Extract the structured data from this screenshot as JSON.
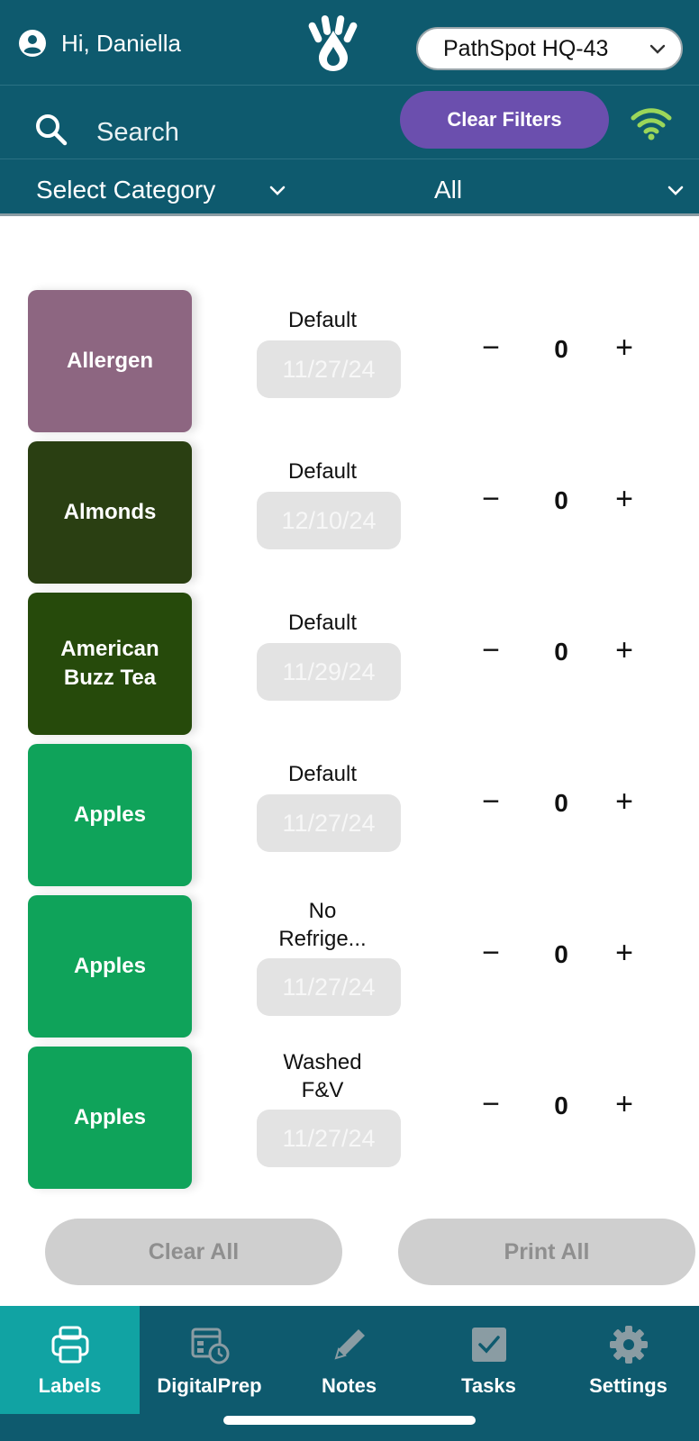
{
  "header": {
    "greeting": "Hi, Daniella",
    "location": "PathSpot HQ-43"
  },
  "search": {
    "placeholder": "Search",
    "clear_filters_label": "Clear Filters"
  },
  "category": {
    "label": "Select Category",
    "value": "All"
  },
  "items": [
    {
      "name": "Allergen",
      "color": "#8d6681",
      "prep": "Default",
      "date": "11/27/24",
      "qty": "0"
    },
    {
      "name": "Almonds",
      "color": "#2a3f12",
      "prep": "Default",
      "date": "12/10/24",
      "qty": "0"
    },
    {
      "name": "American Buzz Tea",
      "color": "#264a0b",
      "prep": "Default",
      "date": "11/29/24",
      "qty": "0"
    },
    {
      "name": "Apples",
      "color": "#0fa35a",
      "prep": "Default",
      "date": "11/27/24",
      "qty": "0"
    },
    {
      "name": "Apples",
      "color": "#0fa35a",
      "prep": "No Refrige...",
      "date": "11/27/24",
      "qty": "0"
    },
    {
      "name": "Apples",
      "color": "#0fa35a",
      "prep": "Washed F&V",
      "date": "11/27/24",
      "qty": "0"
    }
  ],
  "stepper": {
    "minus": "−",
    "plus": "+"
  },
  "actions": {
    "clear_all": "Clear All",
    "print_all": "Print All"
  },
  "tabs": [
    {
      "label": "Labels",
      "icon": "printer-icon",
      "active": true
    },
    {
      "label": "DigitalPrep",
      "icon": "calendar-clock-icon",
      "active": false
    },
    {
      "label": "Notes",
      "icon": "pencil-icon",
      "active": false
    },
    {
      "label": "Tasks",
      "icon": "checkbox-icon",
      "active": false
    },
    {
      "label": "Settings",
      "icon": "gear-icon",
      "active": false
    }
  ],
  "colors": {
    "header_bg": "#0e5a6e",
    "accent_purple": "#6b4fae",
    "active_tab": "#11a3a3",
    "wifi_green": "#9bd65a"
  }
}
